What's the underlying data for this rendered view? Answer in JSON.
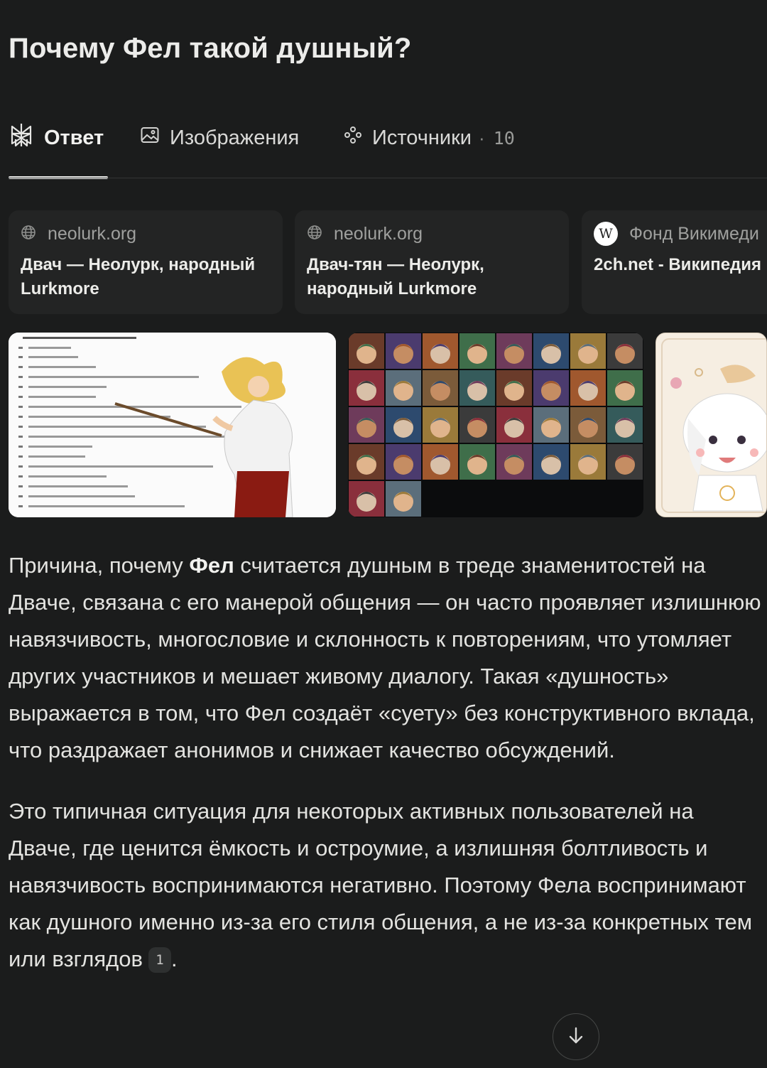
{
  "question": {
    "title": "Почему Фел такой душный?"
  },
  "tabs": [
    {
      "label": "Ответ",
      "icon": "perplexity-logo-icon",
      "active": true
    },
    {
      "label": "Изображения",
      "icon": "image-icon"
    },
    {
      "label": "Источники",
      "icon": "sources-icon",
      "count": "10",
      "separator": "·"
    }
  ],
  "sources": [
    {
      "host": "neolurk.org",
      "icon": "globe-icon",
      "title_line1": "Двач — Неолурк, народный",
      "title_line2": "Lurkmore"
    },
    {
      "host": "neolurk.org",
      "icon": "globe-icon",
      "title_line1": "Двач-тян — Неолурк,",
      "title_line2": "народный Lurkmore"
    },
    {
      "host": "Фонд Викимеди",
      "icon": "wikipedia-icon",
      "badge": "W",
      "title_line1": "2ch.net - Википедия"
    }
  ],
  "images": [
    {
      "name": "anime-teacher-pointer-image"
    },
    {
      "name": "character-portrait-grid-image"
    },
    {
      "name": "chibi-character-image"
    }
  ],
  "answer": {
    "p1_before": "Причина, почему ",
    "p1_bold": "Фел",
    "p1_after": " считается душным в треде знаменитостей на Дваче, связана с его манерой общения — он часто проявляет излишнюю навязчивость, многословие и склонность к повторениям, что утомляет других участников и мешает живому диалогу. Такая «душность» выражается в том, что Фел создаёт «суету» без конструктивного вклада, что раздражает анонимов и снижает качество обсуждений.",
    "p2": "Это типичная ситуация для некоторых активных пользователей на Дваче, где ценится ёмкость и остроумие, а излишняя болтливость и навязчивость воспринимаются негативно. Поэтому Фела воспринимают как душного именно из-за его стиля общения, а не из-за конкретных тем или взглядов",
    "citation": "1",
    "p2_end": "."
  },
  "colors": {
    "background": "#1b1c1c",
    "card": "#232424",
    "text": "#e3e3e0",
    "muted": "#9fa09e"
  }
}
